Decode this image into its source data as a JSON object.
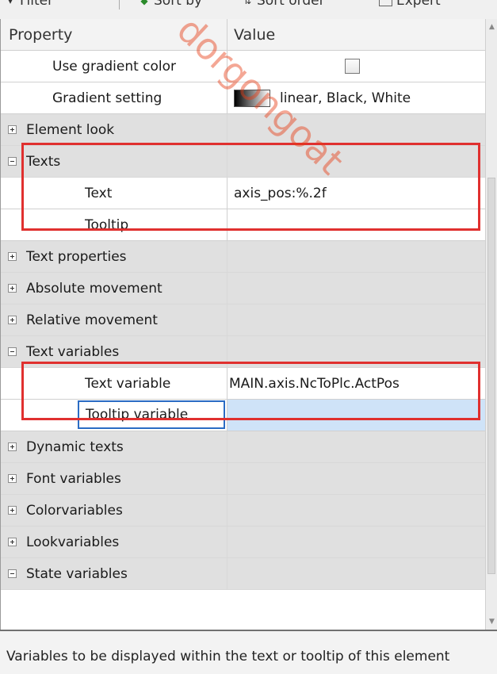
{
  "toolbar": {
    "filter_label": "Filter",
    "sort_by_label": "Sort by",
    "sort_order_label": "Sort order",
    "expert_label": "Expert"
  },
  "header": {
    "property": "Property",
    "value": "Value"
  },
  "rows": [
    {
      "property": "Use gradient color",
      "value": ""
    },
    {
      "property": "Gradient setting",
      "value": "linear, Black, White"
    },
    {
      "property": "Element look",
      "value": ""
    },
    {
      "property": "Texts",
      "value": ""
    },
    {
      "property": "Text",
      "value": "axis_pos:%.2f"
    },
    {
      "property": "Tooltip",
      "value": ""
    },
    {
      "property": "Text properties",
      "value": ""
    },
    {
      "property": "Absolute movement",
      "value": ""
    },
    {
      "property": "Relative movement",
      "value": ""
    },
    {
      "property": "Text variables",
      "value": ""
    },
    {
      "property": "Text variable",
      "value": "MAIN.axis.NcToPlc.ActPos"
    },
    {
      "property": "Tooltip variable",
      "value": ""
    },
    {
      "property": "Dynamic texts",
      "value": ""
    },
    {
      "property": "Font variables",
      "value": ""
    },
    {
      "property": "Colorvariables",
      "value": ""
    },
    {
      "property": "Lookvariables",
      "value": ""
    },
    {
      "property": "State variables",
      "value": ""
    }
  ],
  "description": "Variables to be displayed within the text or tooltip of this element",
  "watermark": "dorgongoat",
  "colors": {
    "highlight": "#e0302f",
    "selection": "#cfe3f8",
    "category_bg": "#e0e0e0"
  }
}
